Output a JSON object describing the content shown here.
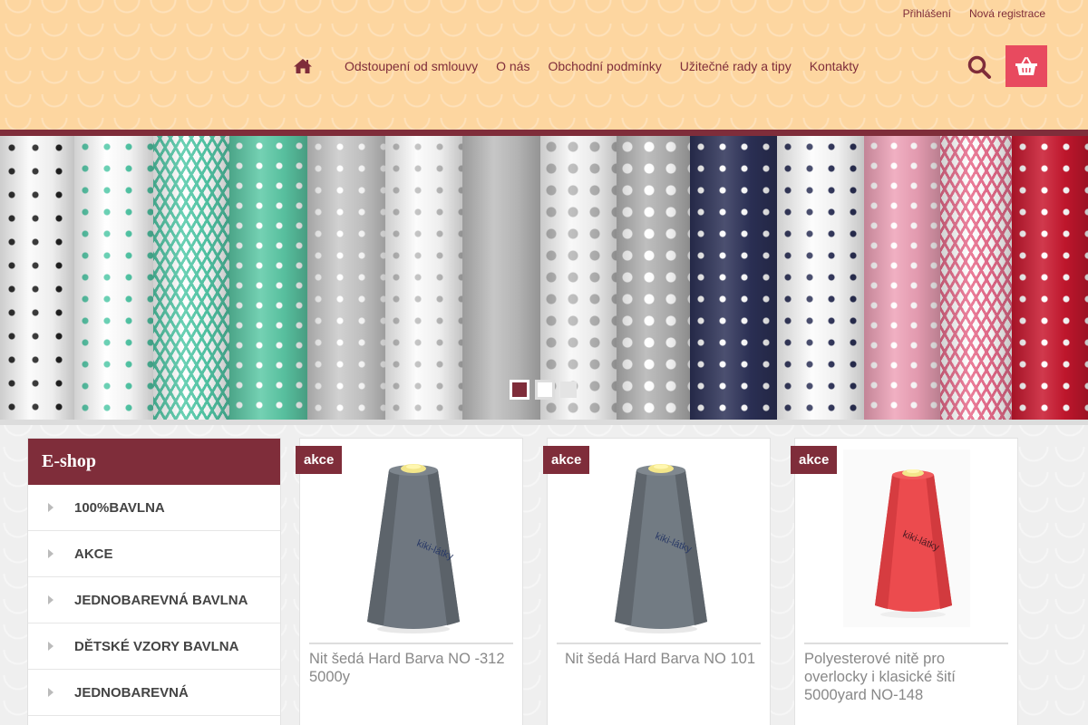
{
  "header": {
    "top_links": [
      "Přihlášení",
      "Nová registrace"
    ],
    "nav_items": [
      "Odstoupení od smlouvy",
      "O nás",
      "Obchodní podmínky",
      "Užitečné rady a tipy",
      "Kontakty"
    ],
    "accent_color": "#7f2d3a",
    "cart_color": "#e84a5f",
    "icons": [
      "home-icon",
      "search-icon",
      "cart-basket-icon"
    ]
  },
  "banner": {
    "slide_count": 3,
    "active_slide": 1
  },
  "sidebar": {
    "title": "E-shop",
    "categories": [
      "100%BAVLNA",
      "AKCE",
      "JEDNOBAREVNÁ BAVLNA",
      "DĚTSKÉ VZORY BAVLNA",
      "JEDNOBAREVNÁ"
    ]
  },
  "products": [
    {
      "badge": "akce",
      "name": "Nit šedá Hard Barva NO -312 5000y",
      "spool_color": "#6c747c",
      "label": "kiki-látky"
    },
    {
      "badge": "akce",
      "name": "Nit šedá Hard Barva NO 101",
      "spool_color": "#6f7880",
      "label": "kiki-látky"
    },
    {
      "badge": "akce",
      "name": "Polyesterové nitě pro overlocky i klasické šití 5000yard NO-148",
      "spool_color": "#e8464a",
      "label": "kiki-látky"
    }
  ]
}
